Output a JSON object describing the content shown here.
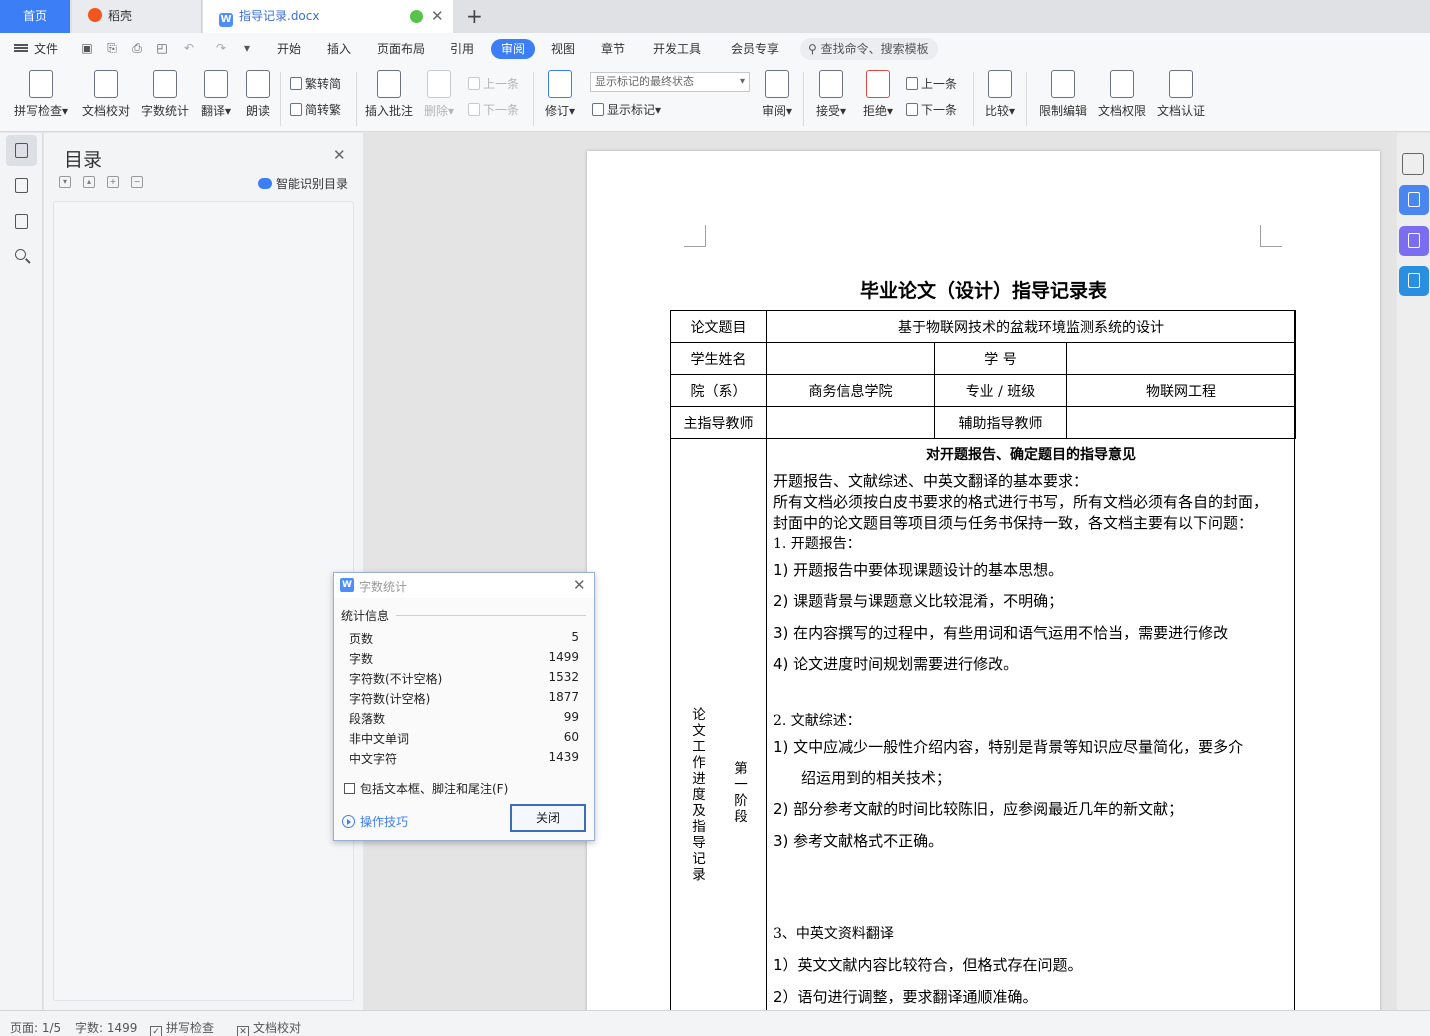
{
  "tabs": {
    "home": "首页",
    "daoke": "稻壳",
    "document": "指导记录.docx",
    "close_glyph": "✕",
    "new_tab_glyph": "+"
  },
  "menu": {
    "file": "文件",
    "items": [
      "开始",
      "插入",
      "页面布局",
      "引用",
      "审阅",
      "视图",
      "章节",
      "开发工具",
      "会员专享"
    ],
    "active": "审阅",
    "search_placeholder": "查找命令、搜索模板"
  },
  "ribbon": {
    "spell_check": "拼写检查",
    "doc_proof": "文档校对",
    "word_count": "字数统计",
    "translate": "翻译",
    "read_aloud": "朗读",
    "trad_to_simp": "繁转简",
    "simp_to_trad": "简转繁",
    "insert_comment": "插入批注",
    "delete": "删除",
    "prev_comment": "上一条",
    "next_comment": "下一条",
    "revise": "修订",
    "markup_state": "显示标记的最终状态",
    "show_markup": "显示标记",
    "review": "审阅",
    "accept": "接受",
    "reject": "拒绝",
    "prev_change": "上一条",
    "next_change": "下一条",
    "compare": "比较",
    "restrict_edit": "限制编辑",
    "doc_permission": "文档权限",
    "doc_cert": "文档认证"
  },
  "toc": {
    "title": "目录",
    "ai_label": "智能识别目录"
  },
  "document": {
    "title": "毕业论文（设计）指导记录表",
    "labels": {
      "topic": "论文题目",
      "student": "学生姓名",
      "student_no": "学  号",
      "college": "院（系）",
      "major": "专业 / 班级",
      "main_advisor": "主指导教师",
      "assistant_advisor": "辅助指导教师",
      "progress": "论文工作进度及指导记录",
      "stage": "第一阶段"
    },
    "values": {
      "topic": "基于物联网技术的盆栽环境监测系统的设计",
      "college": "商务信息学院",
      "major": "物联网工程"
    },
    "content": {
      "heading": "对开题报告、确定题目的指导意见",
      "intro1": "开题报告、文献综述、中英文翻译的基本要求：",
      "intro2": "所有文档必须按白皮书要求的格式进行书写，所有文档必须有各自的封面，",
      "intro3": "封面中的论文题目等项目须与任务书保持一致，各文档主要有以下问题：",
      "s1": "1.   开题报告：",
      "s1_1": "1)   开题报告中要体现课题设计的基本思想。",
      "s1_2": "2)   课题背景与课题意义比较混淆，不明确；",
      "s1_3": "3)   在内容撰写的过程中，有些用词和语气运用不恰当，需要进行修改",
      "s1_4": "4)   论文进度时间规划需要进行修改。",
      "s2": "2.   文献综述：",
      "s2_1a": "1)   文中应减少一般性介绍内容，特别是背景等知识应尽量简化，要多介",
      "s2_1b": "绍运用到的相关技术；",
      "s2_2": "2)   部分参考文献的时间比较陈旧，应参阅最近几年的新文献；",
      "s2_3": "3)   参考文献格式不正确。",
      "s3": "3、中英文资料翻译",
      "s3_1": "1）英文文献内容比较符合，但格式存在问题。",
      "s3_2": "2）语句进行调整，要求翻译通顺准确。"
    }
  },
  "dialog": {
    "title": "字数统计",
    "section": "统计信息",
    "rows": [
      {
        "label": "页数",
        "value": "5"
      },
      {
        "label": "字数",
        "value": "1499"
      },
      {
        "label": "字符数(不计空格)",
        "value": "1532"
      },
      {
        "label": "字符数(计空格)",
        "value": "1877"
      },
      {
        "label": "段落数",
        "value": "99"
      },
      {
        "label": "非中文单词",
        "value": "60"
      },
      {
        "label": "中文字符",
        "value": "1439"
      }
    ],
    "checkbox_label": "包括文本框、脚注和尾注(F)",
    "tips": "操作技巧",
    "close_button": "关闭"
  },
  "status": {
    "page": "页面: 1/5",
    "words": "字数: 1499",
    "spell_check": "拼写检查",
    "proof": "文档校对"
  },
  "colors": {
    "accent": "#3c7ef6",
    "saved": "#57c34b"
  }
}
